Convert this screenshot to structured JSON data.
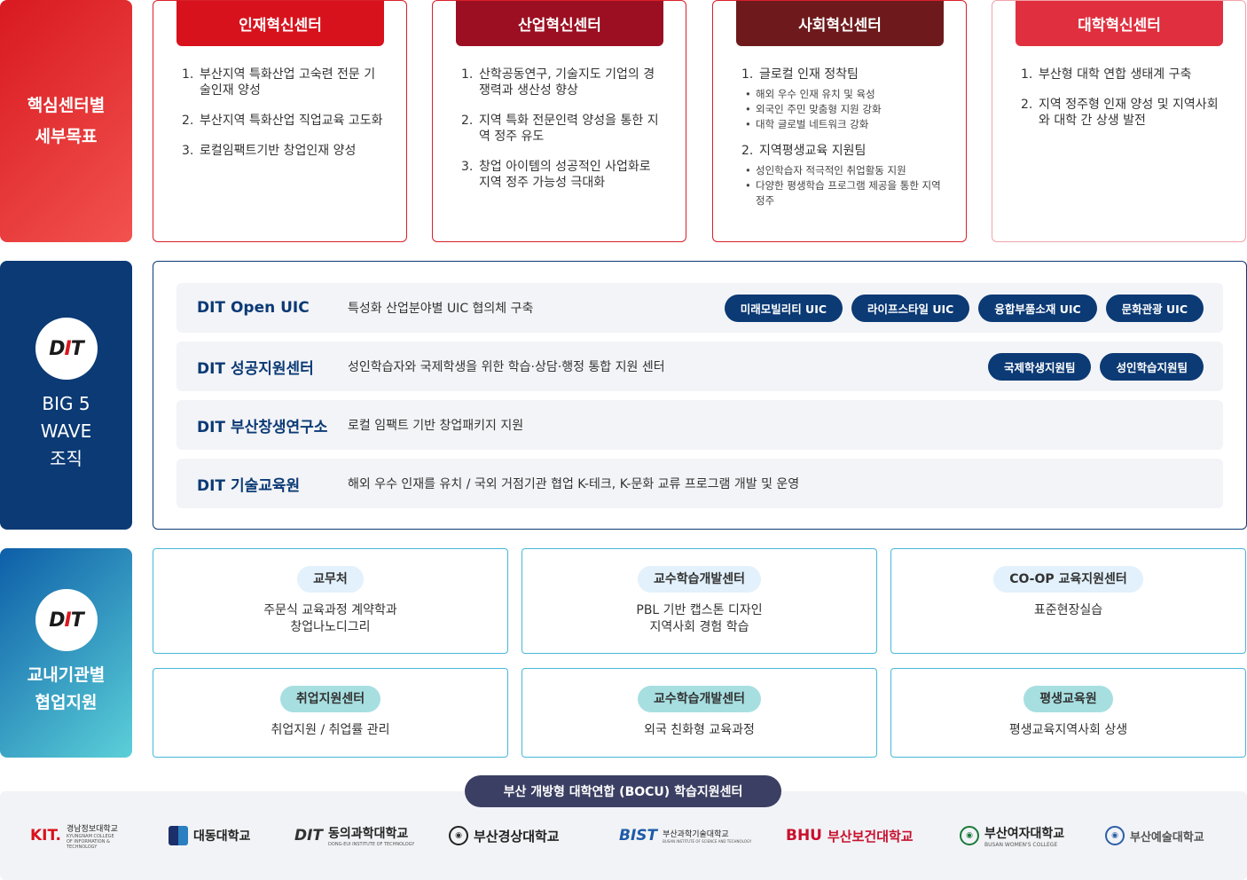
{
  "sections": {
    "core_goals": "핵심센터별\n세부목표",
    "big5": "BIG 5\nWAVE\n조직",
    "internal": "교내기관별\n협업지원"
  },
  "logo": {
    "d": "D",
    "i": "I",
    "t": "T"
  },
  "centers": [
    {
      "title": "인재혁신센터",
      "color": "#d8121c",
      "items": [
        "부산지역 특화산업 고숙련 전문 기술인재 양성",
        "부산지역 특화산업 직업교육 고도화",
        "로컬임팩트기반 창업인재 양성"
      ]
    },
    {
      "title": "산업혁신센터",
      "color": "#9c0f22",
      "items": [
        "산학공동연구, 기술지도 기업의 경쟁력과 생산성 향상",
        "지역 특화 전문인력 양성을 통한 지역 정주 유도",
        "창업 아이템의 성공적인 사업화로 지역 정주 가능성 극대화"
      ]
    },
    {
      "title": "사회혁신센터",
      "color": "#6e1a1c",
      "groups": [
        {
          "title": "글로컬 인재 정착팀",
          "items": [
            "해외 우수 인재 유치 및 육성",
            "외국인 주민 맞춤형 지원 강화",
            "대학 글로벌 네트워크 강화"
          ]
        },
        {
          "title": "지역평생교육 지원팀",
          "items": [
            "성인학습자 적극적인 취업활동 지원",
            "다양한 평생학습 프로그램 제공을 통한 지역 정주"
          ]
        }
      ]
    },
    {
      "title": "대학혁신센터",
      "color": "#e0303f",
      "items": [
        "부산형 대학 연합 생태계 구축",
        "지역 정주형 인재 양성 및 지역사회와 대학 간 상생 발전"
      ]
    }
  ],
  "numbers": [
    "1.",
    "2.",
    "3."
  ],
  "wave": [
    {
      "name": "DIT Open UIC",
      "desc": "특성화 산업분야별 UIC 협의체 구축",
      "pills": [
        "미래모빌리티 UIC",
        "라이프스타일 UIC",
        "융합부품소재 UIC",
        "문화관광 UIC"
      ]
    },
    {
      "name": "DIT 성공지원센터",
      "desc": "성인학습자와 국제학생을 위한 학습·상담·행정 통합 지원 센터",
      "pills": [
        "국제학생지원팀",
        "성인학습지원팀"
      ]
    },
    {
      "name": "DIT 부산창생연구소",
      "desc": "로컬 임팩트 기반 창업패키지 지원",
      "pills": []
    },
    {
      "name": "DIT 기술교육원",
      "desc": "해외 우수 인재를 유치 / 국외 거점기관 협업 K-테크, K-문화 교류 프로그램 개발 및 운영",
      "pills": []
    }
  ],
  "orgs": [
    {
      "tag": "교무처",
      "desc": "주문식 교육과정 계약학과\n창업나노디그리",
      "style": "blue"
    },
    {
      "tag": "교수학습개발센터",
      "desc": "PBL 기반 캡스톤 디자인\n지역사회 경험 학습",
      "style": "blue"
    },
    {
      "tag": "CO-OP 교육지원센터",
      "desc": "표준현장실습",
      "style": "blue"
    },
    {
      "tag": "취업지원센터",
      "desc": "취업지원 / 취업률 관리",
      "style": "teal"
    },
    {
      "tag": "교수학습개발센터",
      "desc": "외국 친화형 교육과정",
      "style": "teal"
    },
    {
      "tag": "평생교육원",
      "desc": "평생교육지역사회 상생",
      "style": "teal"
    }
  ],
  "bocu": "부산 개방형 대학연합 (BOCU) 학습지원센터",
  "universities": [
    {
      "mark": "KIT.",
      "name": "경남정보대학교",
      "sub": "KYUNGNAM COLLEGE OF INFORMATION & TECHNOLOGY"
    },
    {
      "mark": "",
      "name": "대동대학교",
      "sub": ""
    },
    {
      "mark": "DIT",
      "name": "동의과학대학교",
      "sub": "DONG-EUI INSTITUTE OF TECHNOLOGY"
    },
    {
      "mark": "",
      "name": "부산경상대학교",
      "sub": ""
    },
    {
      "mark": "BIST",
      "name": "부산과학기술대학교",
      "sub": "BUSAN INSTITUTE OF SCIENCE AND TECHNOLOGY"
    },
    {
      "mark": "BHU",
      "name": "부산보건대학교",
      "sub": ""
    },
    {
      "mark": "",
      "name": "부산여자대학교",
      "sub": "BUSAN WOMEN'S COLLEGE"
    },
    {
      "mark": "",
      "name": "부산예술대학교",
      "sub": ""
    }
  ]
}
